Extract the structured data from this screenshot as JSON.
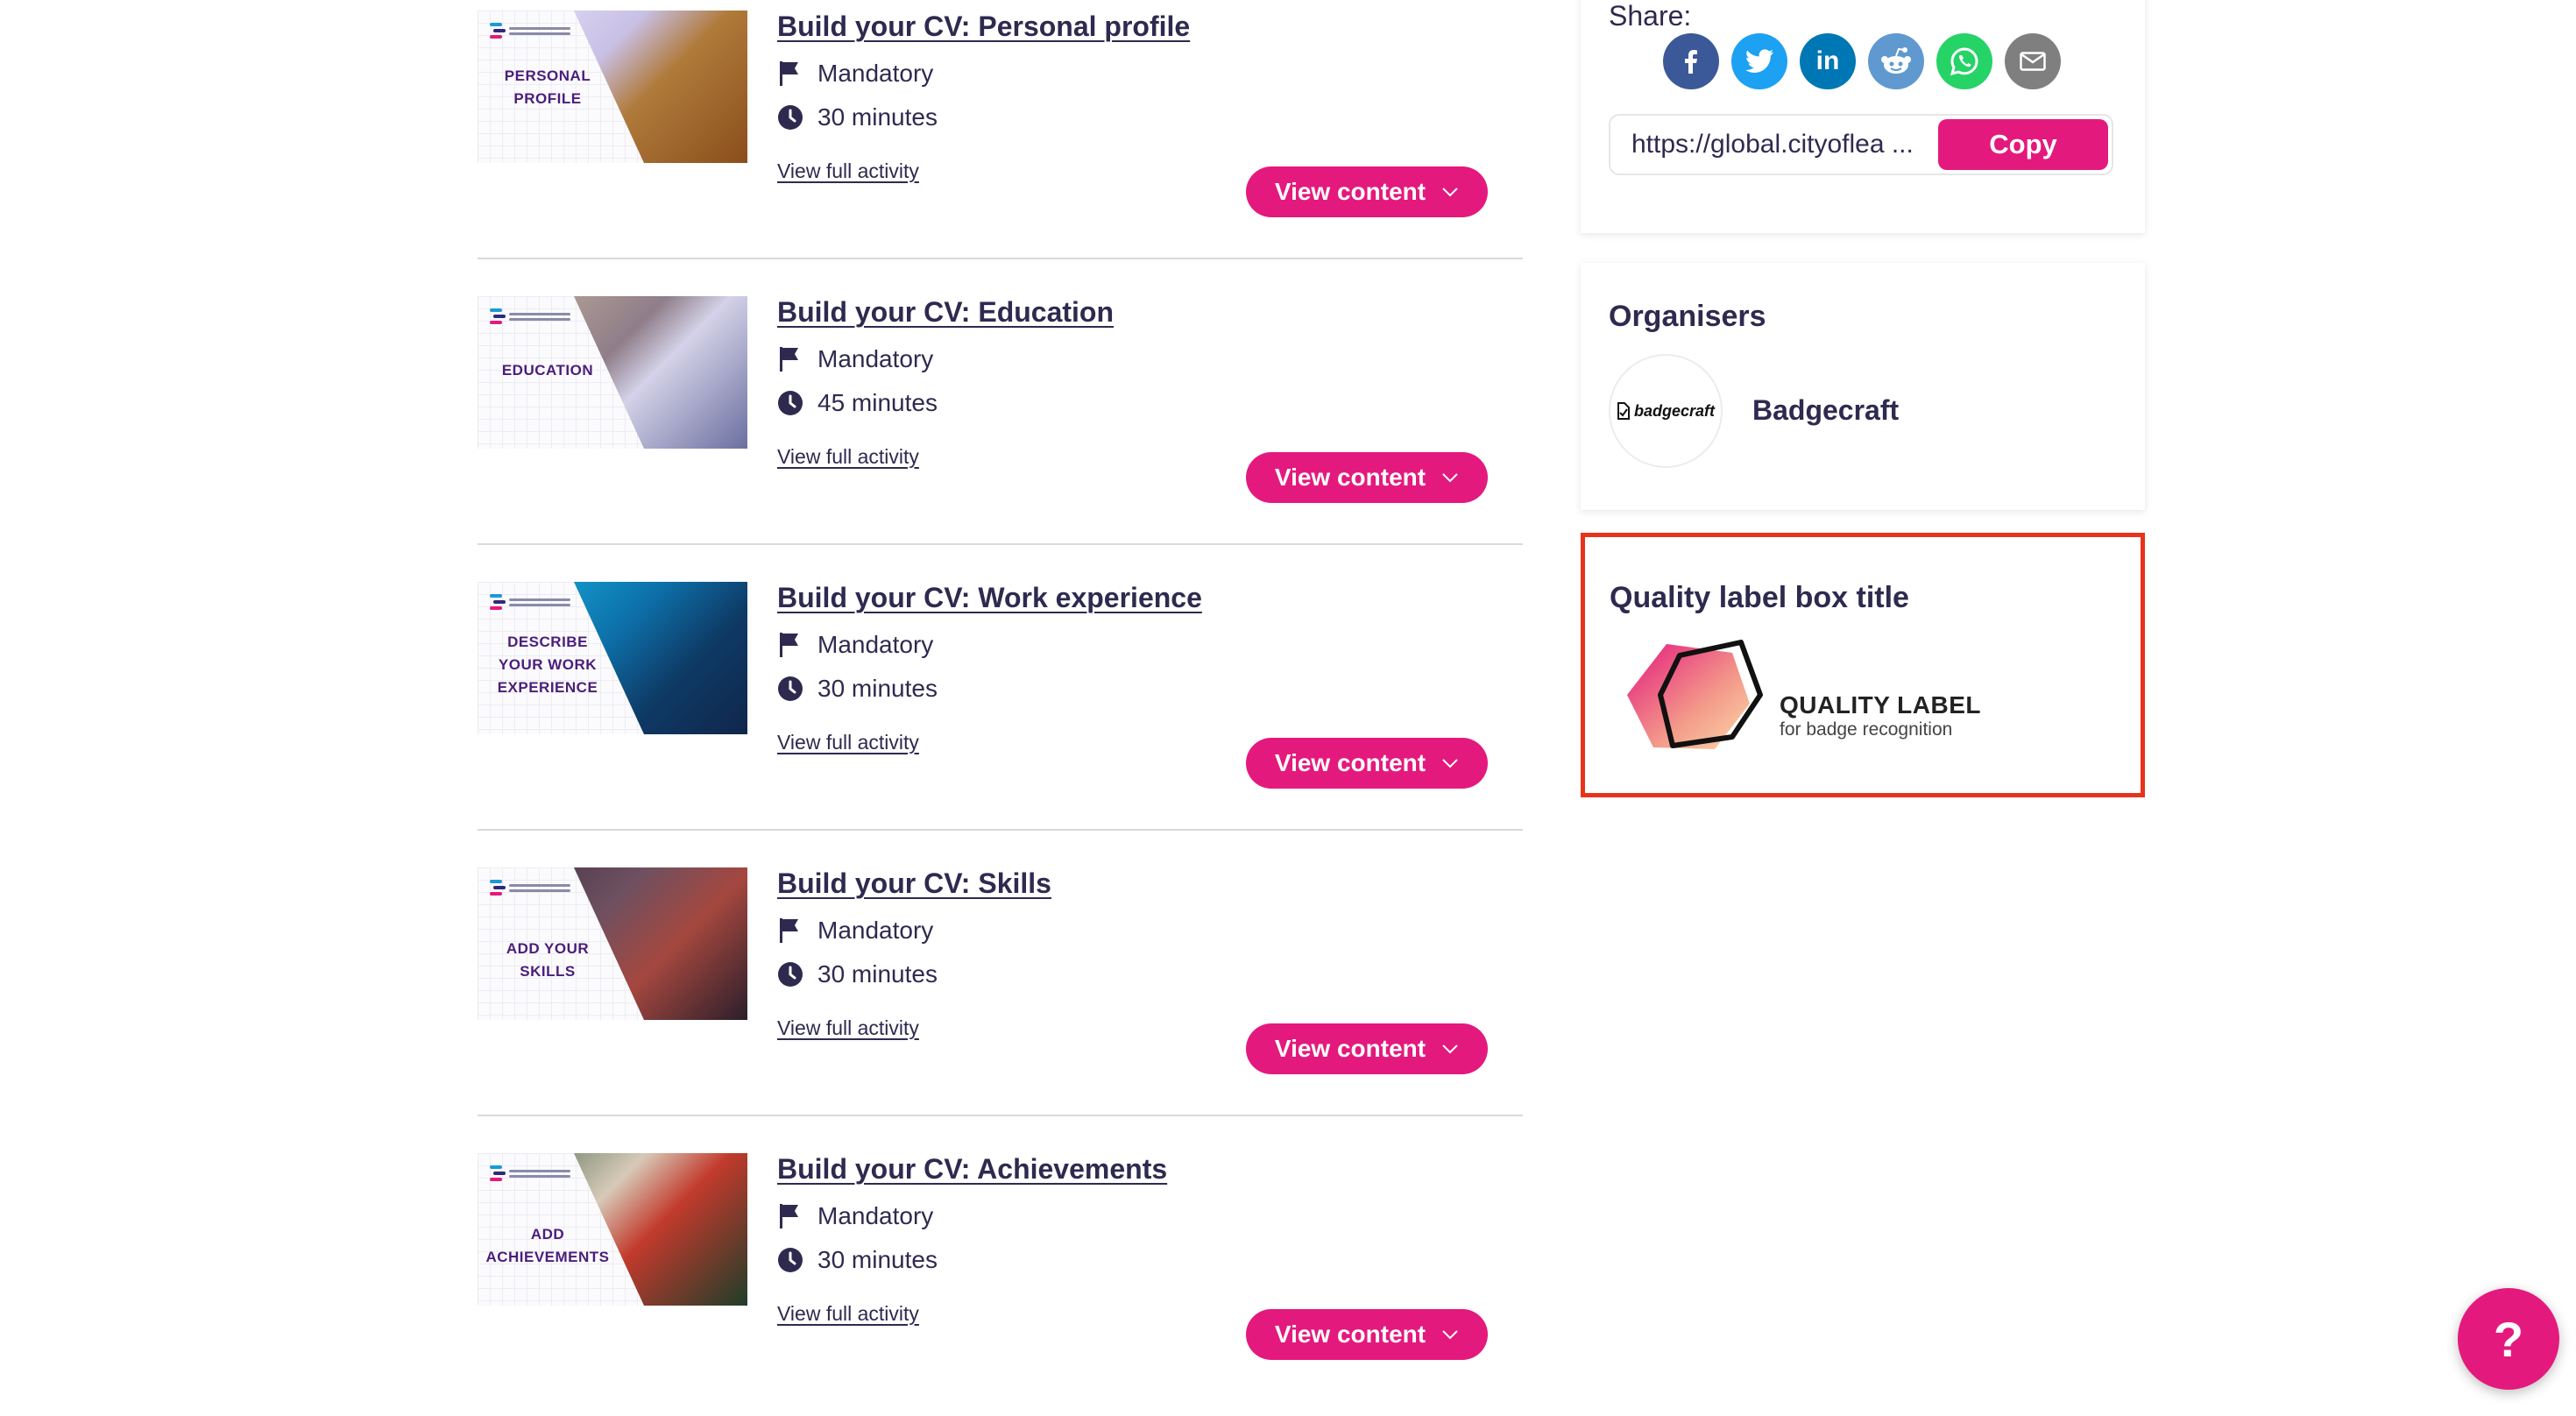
{
  "activities": [
    {
      "title": "Build your CV: Personal profile",
      "requirement": "Mandatory",
      "duration": "30 minutes",
      "link": "View full activity",
      "button": "View content",
      "thumb_caption": [
        "PERSONAL",
        "PROFILE"
      ]
    },
    {
      "title": "Build your CV: Education",
      "requirement": "Mandatory",
      "duration": "45 minutes",
      "link": "View full activity",
      "button": "View content",
      "thumb_caption": [
        "EDUCATION"
      ]
    },
    {
      "title": "Build your CV: Work experience",
      "requirement": "Mandatory",
      "duration": "30 minutes",
      "link": "View full activity",
      "button": "View content",
      "thumb_caption": [
        "DESCRIBE",
        "YOUR WORK",
        "EXPERIENCE"
      ]
    },
    {
      "title": "Build your CV: Skills",
      "requirement": "Mandatory",
      "duration": "30 minutes",
      "link": "View full activity",
      "button": "View content",
      "thumb_caption": [
        "ADD YOUR",
        "SKILLS"
      ]
    },
    {
      "title": "Build your CV: Achievements",
      "requirement": "Mandatory",
      "duration": "30 minutes",
      "link": "View full activity",
      "button": "View content",
      "thumb_caption": [
        "ADD",
        "ACHIEVEMENTS"
      ]
    }
  ],
  "share": {
    "label": "Share:",
    "icons": [
      "facebook-icon",
      "twitter-icon",
      "linkedin-icon",
      "reddit-icon",
      "whatsapp-icon",
      "email-icon"
    ],
    "url": "https://global.cityoflearning.eu/activities/cv",
    "url_display": "https://global.cityoflea ...",
    "copy_label": "Copy"
  },
  "organisers": {
    "title": "Organisers",
    "logo_text": "badgecraft",
    "name": "Badgecraft"
  },
  "quality": {
    "title": "Quality label box title",
    "label_main": "QUALITY LABEL",
    "label_sub": "for badge recognition"
  },
  "help": {
    "label": "?"
  },
  "colors": {
    "accent": "#e4197d",
    "text": "#2e2a4f",
    "highlight_border": "#e8331c",
    "facebook": "#3b5998",
    "twitter": "#1da1f2",
    "linkedin": "#0077b5",
    "reddit": "#5f99cf",
    "whatsapp": "#25d366",
    "email": "#7f7f7f"
  }
}
